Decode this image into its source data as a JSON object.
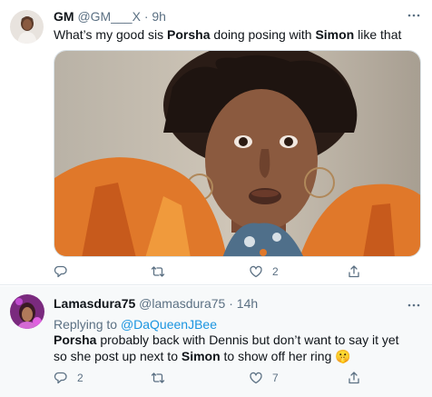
{
  "tweet1": {
    "name": "GM",
    "handle": "@GM___X",
    "dot": "·",
    "time": "9h",
    "text_1": "What’s my good sis ",
    "bold_1": "Porsha",
    "text_2": " doing posing with ",
    "bold_2": "Simon",
    "text_3": " like that",
    "reply_count": "",
    "retweet_count": "",
    "like_count": "2"
  },
  "tweet2": {
    "name": "Lamasdura75",
    "handle": "@lamasdura75",
    "dot": "·",
    "time": "14h",
    "replying_label": "Replying to ",
    "replying_to": "@DaQueenJBee",
    "bold_1": "Porsha",
    "text_1": " probably back with Dennis but don’t want to say it yet so she post up next to ",
    "bold_2": "Simon",
    "text_2": " to show off her ring ",
    "emoji": "🤫",
    "reply_count": "2",
    "retweet_count": "",
    "like_count": "7"
  },
  "colors": {
    "text": "#0f1419",
    "muted": "#5b7083",
    "link": "#1b95e0",
    "divider": "#e6ecf0"
  },
  "icons": [
    "more-icon",
    "reply-icon",
    "retweet-icon",
    "like-icon",
    "share-icon"
  ]
}
